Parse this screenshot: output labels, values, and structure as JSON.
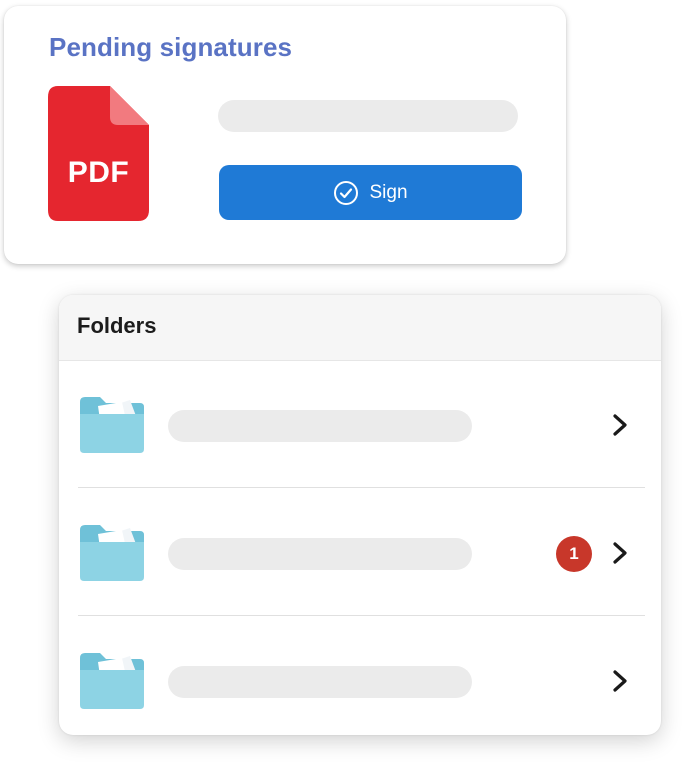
{
  "pending": {
    "title": "Pending signatures",
    "file_type_label": "PDF",
    "sign_label": "Sign"
  },
  "folders": {
    "title": "Folders",
    "rows": [
      {
        "badge": ""
      },
      {
        "badge": "1"
      },
      {
        "badge": ""
      }
    ]
  },
  "icons": {
    "pdf": "pdf-file-icon",
    "check": "check-circle-icon",
    "folder": "folder-icon",
    "chevron": "chevron-right-icon"
  },
  "colors": {
    "title_blue": "#5a73c4",
    "pdf_red": "#e5262f",
    "button_blue": "#1f7ad6",
    "badge_red": "#c8372a",
    "folder_blue": "#8dd3e4",
    "placeholder_gray": "#ebebeb"
  }
}
